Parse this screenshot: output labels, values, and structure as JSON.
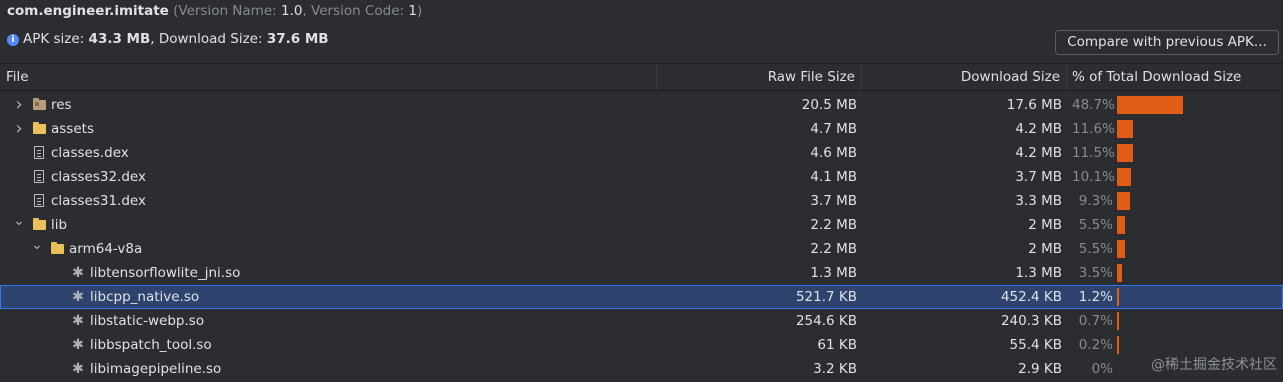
{
  "header": {
    "package": "com.engineer.imitate",
    "version_prefix": "(Version Name: ",
    "version_name": "1.0",
    "version_mid": ", Version Code: ",
    "version_code": "1",
    "version_suffix": ")",
    "apk_size_label": "APK size: ",
    "apk_size": "43.3 MB",
    "download_size_label": ", Download Size: ",
    "download_size": "37.6 MB",
    "compare_button": "Compare with previous APK..."
  },
  "columns": {
    "file": "File",
    "raw": "Raw File Size",
    "download": "Download Size",
    "percent": "% of Total Download Size"
  },
  "rows": [
    {
      "name": "res",
      "raw": "20.5 MB",
      "download": "17.6 MB",
      "percent": "48.7%",
      "percent_value": 48.7,
      "icon": "folder-res-icon",
      "expander": "collapsed",
      "depth": 0
    },
    {
      "name": "assets",
      "raw": "4.7 MB",
      "download": "4.2 MB",
      "percent": "11.6%",
      "percent_value": 11.6,
      "icon": "folder-icon",
      "expander": "collapsed",
      "depth": 0
    },
    {
      "name": "classes.dex",
      "raw": "4.6 MB",
      "download": "4.2 MB",
      "percent": "11.5%",
      "percent_value": 11.5,
      "icon": "dex-file-icon",
      "expander": "none",
      "depth": 0
    },
    {
      "name": "classes32.dex",
      "raw": "4.1 MB",
      "download": "3.7 MB",
      "percent": "10.1%",
      "percent_value": 10.1,
      "icon": "dex-file-icon",
      "expander": "none",
      "depth": 0
    },
    {
      "name": "classes31.dex",
      "raw": "3.7 MB",
      "download": "3.3 MB",
      "percent": "9.3%",
      "percent_value": 9.3,
      "icon": "dex-file-icon",
      "expander": "none",
      "depth": 0
    },
    {
      "name": "lib",
      "raw": "2.2 MB",
      "download": "2 MB",
      "percent": "5.5%",
      "percent_value": 5.5,
      "icon": "folder-icon",
      "expander": "expanded",
      "depth": 0
    },
    {
      "name": "arm64-v8a",
      "raw": "2.2 MB",
      "download": "2 MB",
      "percent": "5.5%",
      "percent_value": 5.5,
      "icon": "folder-icon",
      "expander": "expanded",
      "depth": 1
    },
    {
      "name": "libtensorflowlite_jni.so",
      "raw": "1.3 MB",
      "download": "1.3 MB",
      "percent": "3.5%",
      "percent_value": 3.5,
      "icon": "native-lib-icon",
      "expander": "none",
      "depth": 2
    },
    {
      "name": "libcpp_native.so",
      "raw": "521.7 KB",
      "download": "452.4 KB",
      "percent": "1.2%",
      "percent_value": 1.2,
      "icon": "native-lib-icon",
      "expander": "none",
      "depth": 2,
      "selected": true
    },
    {
      "name": "libstatic-webp.so",
      "raw": "254.6 KB",
      "download": "240.3 KB",
      "percent": "0.7%",
      "percent_value": 0.7,
      "icon": "native-lib-icon",
      "expander": "none",
      "depth": 2
    },
    {
      "name": "libbspatch_tool.so",
      "raw": "61 KB",
      "download": "55.4 KB",
      "percent": "0.2%",
      "percent_value": 0.2,
      "icon": "native-lib-icon",
      "expander": "none",
      "depth": 2
    },
    {
      "name": "libimagepipeline.so",
      "raw": "3.2 KB",
      "download": "2.9 KB",
      "percent": "0%",
      "percent_value": 0,
      "icon": "native-lib-icon",
      "expander": "none",
      "depth": 2
    }
  ],
  "colors": {
    "bar": "#e15d16",
    "selection": "#2e436e",
    "folder": "#e9c15a"
  },
  "watermark": "@稀土掘金技术社区"
}
